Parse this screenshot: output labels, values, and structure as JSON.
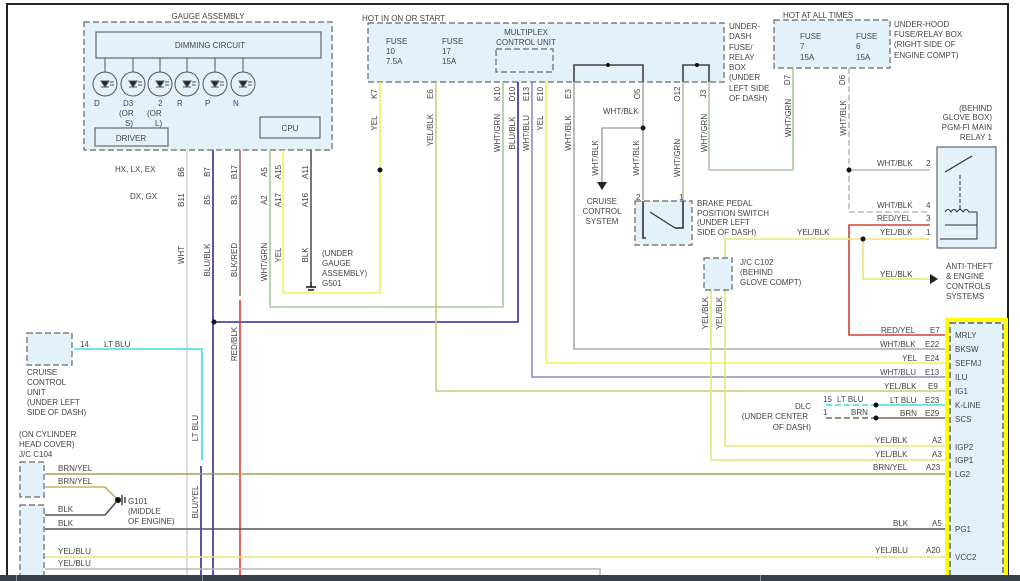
{
  "colors": {
    "yel": "#f0f060",
    "yel_blk": "#c9cc7a",
    "wht": "#cfcfcf",
    "blu_blk": "#2c2c9a",
    "red": "#d2403a",
    "wht_grn": "#a9c99a",
    "wht_blu": "#8c8cc8",
    "wht_blk": "#aaaaaa",
    "lt_blu": "#3fdde0",
    "brn_yel": "#a89a5a",
    "blk": "#555555",
    "brn": "#7a6a4a",
    "ecm_highlight": "#ffff00",
    "component_fill": "#e3f1fb"
  },
  "labels": {
    "gauge_assembly": "GAUGE ASSEMBLY",
    "dimming_circuit": "DIMMING CIRCUIT",
    "led_d": "D",
    "led_d3": "D3",
    "led_d3_or": "(OR",
    "led_d3_s": "S)",
    "led_2": "2",
    "led_2_or": "(OR",
    "led_2_l": "L)",
    "led_r": "R",
    "led_p": "P",
    "led_n": "N",
    "driver": "DRIVER",
    "cpu": "CPU",
    "pin_b6": "B6",
    "pin_b7": "B7",
    "pin_b17": "B17",
    "pin_a5": "A5",
    "pin_a15": "A15",
    "pin_a11": "A11",
    "pin_b11": "B11",
    "pin_b5": "B5",
    "pin_b3": "B3",
    "pin_a2": "A2",
    "pin_a17": "A17",
    "pin_a16": "A16",
    "models_hx": "HX, LX, EX",
    "models_dx": "DX, GX",
    "w_wht": "WHT",
    "w_blublk": "BLU/BLK",
    "w_blkred": "BLK/RED",
    "w_whtgrn_g": "WHT/GRN",
    "w_yel_g": "YEL",
    "w_blk_g": "BLK",
    "g501_1": "(UNDER",
    "g501_2": "GAUGE",
    "g501_3": "ASSEMBLY)",
    "g501_4": "G501",
    "hot_on_start": "HOT IN ON OR START",
    "fuse10_a": "FUSE",
    "fuse10_b": "10",
    "fuse10_c": "7.5A",
    "fuse17_a": "FUSE",
    "fuse17_b": "17",
    "fuse17_c": "15A",
    "mcu_1": "MULTIPLEX",
    "mcu_2": "CONTROL UNIT",
    "pin_k7": "K7",
    "pin_e6": "E6",
    "pin_k10": "K10",
    "pin_d10": "D10",
    "pin_e13": "E13",
    "pin_e10": "E10",
    "pin_e3": "E3",
    "pin_o5": "O5",
    "pin_o12": "O12",
    "pin_j3": "J3",
    "udb_1": "UNDER-",
    "udb_2": "DASH",
    "udb_3": "FUSE/",
    "udb_4": "RELAY",
    "udb_5": "BOX",
    "udb_6": "(UNDER",
    "udb_7": "LEFT SIDE",
    "udb_8": "OF DASH)",
    "hot_all_times": "HOT AT ALL TIMES",
    "fuse7_a": "FUSE",
    "fuse7_b": "7",
    "fuse7_c": "15A",
    "fuse6_a": "FUSE",
    "fuse6_b": "6",
    "fuse6_c": "15A",
    "uhb_1": "UNDER-HOOD",
    "uhb_2": "FUSE/RELAY BOX",
    "uhb_3": "(RIGHT SIDE OF",
    "uhb_4": "ENGINE COMPT)",
    "pin_d7": "D7",
    "pin_d6": "D6",
    "w_yel_k7": "YEL",
    "w_yelblk_e6": "YEL/BLK",
    "w_whtgrn_k10": "WHT/GRN",
    "w_blublk_d10": "BLU/BLK",
    "w_whtblu_e13": "WHT/BLU",
    "w_yel_e10": "YEL",
    "w_whtblk_e3": "WHT/BLK",
    "w_whtblk_o5h": "WHT/BLK",
    "w_whtblk_cc": "WHT/BLK",
    "w_whtblk_o5": "WHT/BLK",
    "w_whtgrn_o12": "WHT/GRN",
    "w_whtgrn_j3": "WHT/GRN",
    "w_whtgrn_d7": "WHT/GRN",
    "w_whtblk_d6": "WHT/BLK",
    "ccs_1": "CRUISE",
    "ccs_2": "CONTROL",
    "ccs_3": "SYSTEM",
    "bpp_pin2": "2",
    "bpp_pin1": "1",
    "bpp_1": "BRAKE PEDAL",
    "bpp_2": "POSITION SWITCH",
    "bpp_3": "(UNDER LEFT",
    "bpp_4": "SIDE OF DASH)",
    "relay_1": "(BEHIND",
    "relay_2": "GLOVE BOX)",
    "relay_3": "PGM-FI MAIN",
    "relay_4": "RELAY 1",
    "r_w2": "WHT/BLK",
    "r_p2": "2",
    "r_w4": "WHT/BLK",
    "r_p4": "4",
    "r_w3": "RED/YEL",
    "r_p3": "3",
    "r_w1": "YEL/BLK",
    "r_p1": "1",
    "w_yelblk_top": "YEL/BLK",
    "w_yelblk_at": "YEL/BLK",
    "at_1": "ANTI-THEFT",
    "at_2": "& ENGINE",
    "at_3": "CONTROLS",
    "at_4": "SYSTEMS",
    "c102_1": "J/C C102",
    "c102_2": "(BEHIND",
    "c102_3": "GLOVE COMPT)",
    "w_c102_a": "YEL/BLK",
    "w_c102_b": "YEL/BLK",
    "e_w7": "RED/YEL",
    "e_p7": "E7",
    "e_n7": "MRLY",
    "e_w22": "WHT/BLK",
    "e_p22": "E22",
    "e_n22": "BKSW",
    "e_w24": "YEL",
    "e_p24": "E24",
    "e_n24": "SEFMJ",
    "e_w13": "WHT/BLU",
    "e_p13": "E13",
    "e_n13": "ILU",
    "e_w9": "YEL/BLK",
    "e_p9": "E9",
    "e_n9": "IG1",
    "e_w23": "LT BLU",
    "e_p23": "E23",
    "e_n23": "K-LINE",
    "e_w29": "BRN",
    "e_p29": "E29",
    "e_n29": "SCS",
    "dlc_15": "15",
    "dlc_ltblu": "LT BLU",
    "dlc_1": "1",
    "dlc_brn": "BRN",
    "dlc_a": "DLC",
    "dlc_b": "(UNDER CENTER",
    "dlc_c": "OF DASH)",
    "a_w2": "YEL/BLK",
    "a_p2": "A2",
    "a_n2": "IGP2",
    "a_w3": "YEL/BLK",
    "a_p3": "A3",
    "a_n3": "IGP1",
    "a_w23": "BRN/YEL",
    "a_p23": "A23",
    "a_n23": "LG2",
    "a_w5": "BLK",
    "a_p5": "A5",
    "a_n5": "PG1",
    "a_w20": "YEL/BLU",
    "a_p20": "A20",
    "a_n20": "VCC2",
    "ccu_pin": "14",
    "ccu_wire": "LT BLU",
    "ccu_1": "CRUISE",
    "ccu_2": "CONTROL",
    "ccu_3": "UNIT",
    "ccu_4": "(UNDER LEFT",
    "ccu_5": "SIDE OF DASH)",
    "w_ltblu_v": "LT BLU",
    "w_redblk": "RED/BLK",
    "w_bluyel": "BLU/YEL",
    "c104_1": "(ON CYLINDER",
    "c104_2": "HEAD COVER)",
    "c104_3": "J/C C104",
    "c104_w1": "BRN/YEL",
    "c104_w2": "BRN/YEL",
    "c104_w3": "BLK",
    "c104_w4": "BLK",
    "c104_w5": "YEL/BLU",
    "c104_w6": "YEL/BLU",
    "g101_1": "G101",
    "g101_2": "(MIDDLE",
    "g101_3": "OF ENGINE)"
  }
}
